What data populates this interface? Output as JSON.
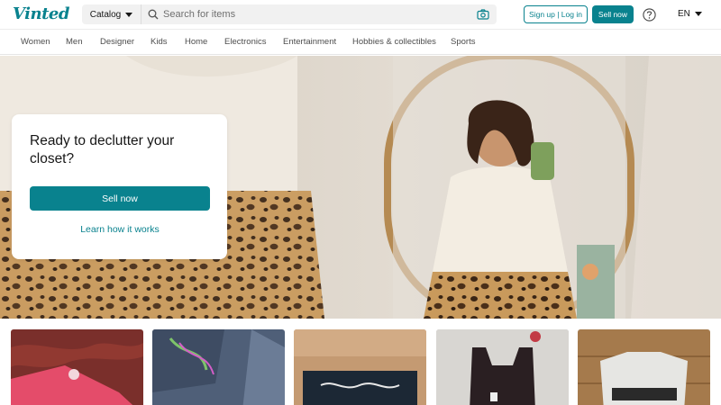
{
  "header": {
    "logo": "Vinted",
    "catalog_label": "Catalog",
    "search_placeholder": "Search for items",
    "signup_label": "Sign up | Log in",
    "sellnow_label": "Sell now",
    "language": "EN",
    "icons": [
      "search-icon",
      "camera-icon",
      "help-icon",
      "chevron-down-icon"
    ],
    "accent_color": "#09828e"
  },
  "nav": {
    "items": [
      "Women",
      "Men",
      "Designer",
      "Kids",
      "Home",
      "Electronics",
      "Entertainment",
      "Hobbies & collectibles",
      "Sports"
    ]
  },
  "hero": {
    "title": "Ready to declutter your closet?",
    "sell_button": "Sell now",
    "learn_link": "Learn how it works"
  },
  "items": [
    {
      "name": "pink-item"
    },
    {
      "name": "denim-item"
    },
    {
      "name": "black-item"
    },
    {
      "name": "black-top-item"
    },
    {
      "name": "white-shirt-item"
    }
  ]
}
